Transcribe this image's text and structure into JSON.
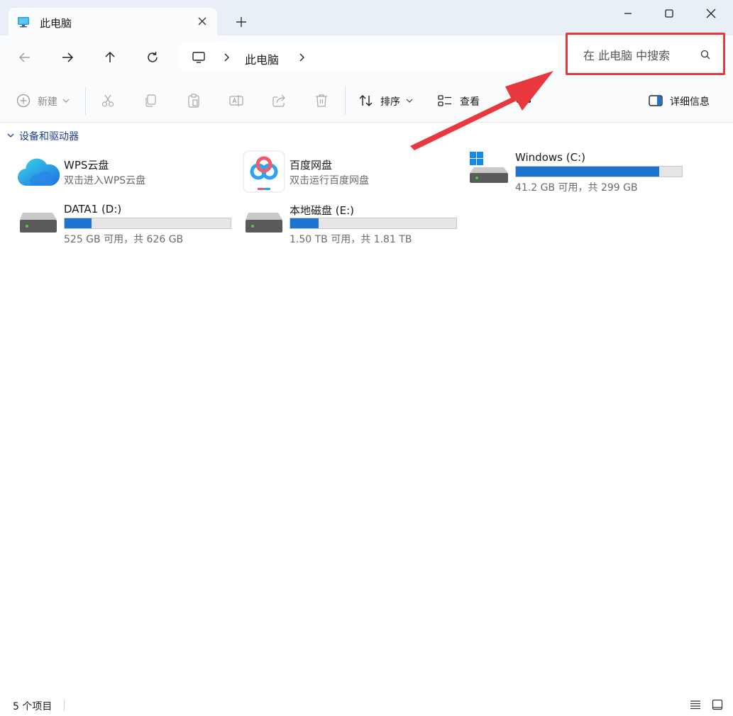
{
  "tab": {
    "title": "此电脑"
  },
  "address": {
    "location": "此电脑"
  },
  "search": {
    "placeholder": "在 此电脑 中搜索"
  },
  "toolbar": {
    "new_label": "新建",
    "sort_label": "排序",
    "view_label": "查看",
    "details_label": "详细信息"
  },
  "section": {
    "title": "设备和驱动器"
  },
  "items": [
    {
      "name": "WPS云盘",
      "sub": "双击进入WPS云盘",
      "icon": "wps-cloud-icon"
    },
    {
      "name": "百度网盘",
      "sub": "双击运行百度网盘",
      "icon": "baidu-netdisk-icon"
    },
    {
      "name": "Windows (C:)",
      "sub": "41.2 GB 可用，共 299 GB",
      "icon": "windows-drive-icon",
      "used_fraction": 0.862
    },
    {
      "name": "DATA1 (D:)",
      "sub": "525 GB 可用，共 626 GB",
      "icon": "hard-drive-icon",
      "used_fraction": 0.161
    },
    {
      "name": "本地磁盘 (E:)",
      "sub": "1.50 TB 可用，共 1.81 TB",
      "icon": "hard-drive-icon",
      "used_fraction": 0.171
    }
  ],
  "status": {
    "count": "5 个项目"
  },
  "colors": {
    "accent": "#1b74d0",
    "annotation": "#e8383d"
  }
}
